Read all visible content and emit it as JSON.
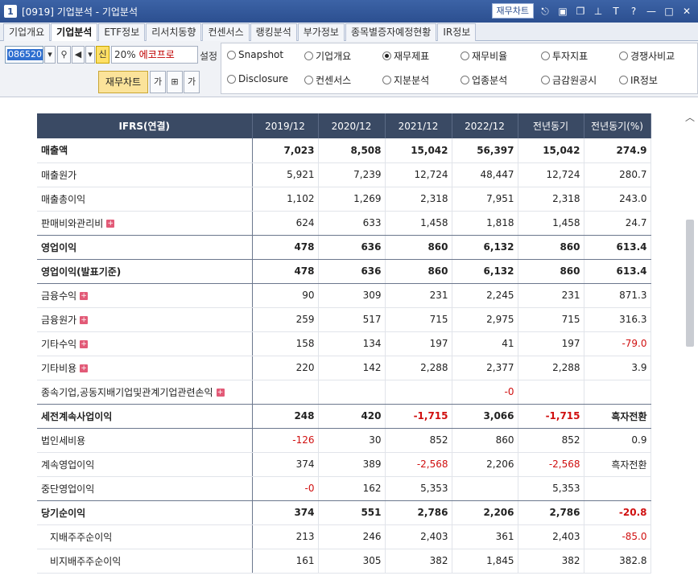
{
  "window": {
    "number": "1",
    "title": "[0919] 기업분석 - 기업분석",
    "jm_button": "재무차트"
  },
  "tabs": [
    "기업개요",
    "기업분석",
    "ETF정보",
    "리서치동향",
    "컨센서스",
    "랭킹분석",
    "부가정보",
    "종목별증자예정현황",
    "IR정보"
  ],
  "toolbar": {
    "code": "086520",
    "shin": "신",
    "zoom": "20%",
    "name": "에코프로",
    "setting": "설정",
    "jm_chart": "재무차트",
    "ga": "가",
    "ga2": "가"
  },
  "radios": [
    {
      "label": "Snapshot",
      "checked": false
    },
    {
      "label": "기업개요",
      "checked": false
    },
    {
      "label": "재무제표",
      "checked": true
    },
    {
      "label": "재무비율",
      "checked": false
    },
    {
      "label": "투자지표",
      "checked": false
    },
    {
      "label": "경쟁사비교",
      "checked": false
    },
    {
      "label": "Disclosure",
      "checked": false
    },
    {
      "label": "컨센서스",
      "checked": false
    },
    {
      "label": "지분분석",
      "checked": false
    },
    {
      "label": "업종분석",
      "checked": false
    },
    {
      "label": "금감원공시",
      "checked": false
    },
    {
      "label": "IR정보",
      "checked": false
    }
  ],
  "table": {
    "headers": [
      "IFRS(연결)",
      "2019/12",
      "2020/12",
      "2021/12",
      "2022/12",
      "전년동기",
      "전년동기(%)"
    ],
    "rows": [
      {
        "label": "매출액",
        "bold": true,
        "plus": false,
        "indent": false,
        "values": [
          "7,023",
          "8,508",
          "15,042",
          "56,397",
          "15,042",
          "274.9"
        ]
      },
      {
        "label": "매출원가",
        "bold": false,
        "plus": false,
        "indent": false,
        "values": [
          "5,921",
          "7,239",
          "12,724",
          "48,447",
          "12,724",
          "280.7"
        ]
      },
      {
        "label": "매출총이익",
        "bold": false,
        "plus": false,
        "indent": false,
        "values": [
          "1,102",
          "1,269",
          "2,318",
          "7,951",
          "2,318",
          "243.0"
        ]
      },
      {
        "label": "판매비와관리비",
        "bold": false,
        "plus": true,
        "indent": false,
        "values": [
          "624",
          "633",
          "1,458",
          "1,818",
          "1,458",
          "24.7"
        ]
      },
      {
        "label": "영업이익",
        "bold": true,
        "plus": false,
        "indent": false,
        "values": [
          "478",
          "636",
          "860",
          "6,132",
          "860",
          "613.4"
        ]
      },
      {
        "label": "영업이익(발표기준)",
        "bold": true,
        "plus": false,
        "indent": false,
        "values": [
          "478",
          "636",
          "860",
          "6,132",
          "860",
          "613.4"
        ]
      },
      {
        "label": "금융수익",
        "bold": false,
        "plus": true,
        "indent": false,
        "values": [
          "90",
          "309",
          "231",
          "2,245",
          "231",
          "871.3"
        ]
      },
      {
        "label": "금융원가",
        "bold": false,
        "plus": true,
        "indent": false,
        "values": [
          "259",
          "517",
          "715",
          "2,975",
          "715",
          "316.3"
        ]
      },
      {
        "label": "기타수익",
        "bold": false,
        "plus": true,
        "indent": false,
        "values": [
          "158",
          "134",
          "197",
          "41",
          "197",
          "-79.0"
        ]
      },
      {
        "label": "기타비용",
        "bold": false,
        "plus": true,
        "indent": false,
        "values": [
          "220",
          "142",
          "2,288",
          "2,377",
          "2,288",
          "3.9"
        ]
      },
      {
        "label": "종속기업,공동지배기업및관계기업관련손익",
        "bold": false,
        "plus": true,
        "indent": false,
        "values": [
          "",
          "",
          "",
          "-0",
          "",
          ""
        ]
      },
      {
        "label": "세전계속사업이익",
        "bold": true,
        "plus": false,
        "indent": false,
        "values": [
          "248",
          "420",
          "-1,715",
          "3,066",
          "-1,715",
          "흑자전환"
        ]
      },
      {
        "label": "법인세비용",
        "bold": false,
        "plus": false,
        "indent": false,
        "values": [
          "-126",
          "30",
          "852",
          "860",
          "852",
          "0.9"
        ]
      },
      {
        "label": "계속영업이익",
        "bold": false,
        "plus": false,
        "indent": false,
        "values": [
          "374",
          "389",
          "-2,568",
          "2,206",
          "-2,568",
          "흑자전환"
        ]
      },
      {
        "label": "중단영업이익",
        "bold": false,
        "plus": false,
        "indent": false,
        "values": [
          "-0",
          "162",
          "5,353",
          "",
          "5,353",
          ""
        ]
      },
      {
        "label": "당기순이익",
        "bold": true,
        "plus": false,
        "indent": false,
        "values": [
          "374",
          "551",
          "2,786",
          "2,206",
          "2,786",
          "-20.8"
        ]
      },
      {
        "label": "지배주주순이익",
        "bold": false,
        "plus": false,
        "indent": true,
        "values": [
          "213",
          "246",
          "2,403",
          "361",
          "2,403",
          "-85.0"
        ]
      },
      {
        "label": "비지배주주순이익",
        "bold": false,
        "plus": false,
        "indent": true,
        "values": [
          "161",
          "305",
          "382",
          "1,845",
          "382",
          "382.8"
        ]
      }
    ]
  },
  "icons": [
    "dropdown-arrow-icon",
    "search-icon",
    "speaker-icon",
    "link-icon",
    "restore-icon",
    "copy-icon",
    "pin-icon",
    "font-icon",
    "help-icon",
    "minimize-icon",
    "maximize-icon",
    "close-icon",
    "scroll-up-icon"
  ]
}
